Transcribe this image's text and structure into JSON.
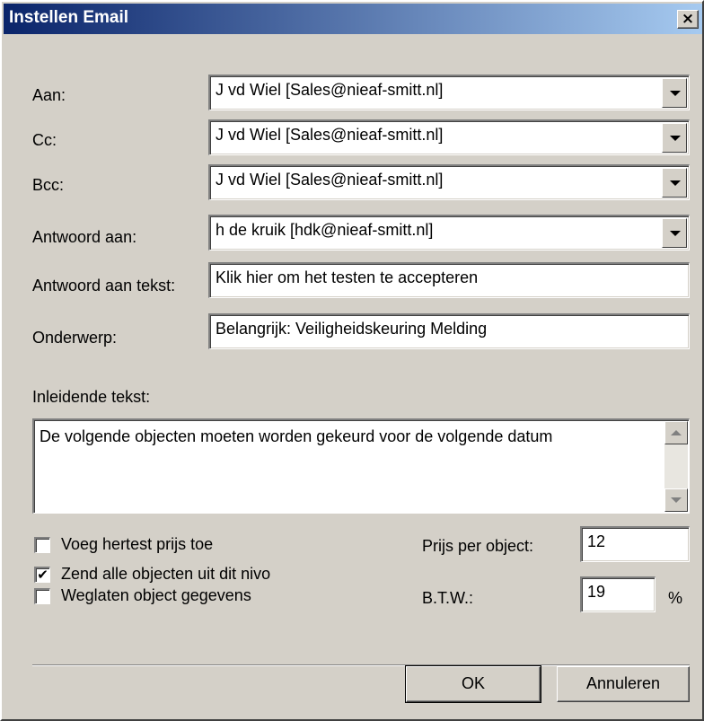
{
  "window": {
    "title": "Instellen Email",
    "close_glyph": "×"
  },
  "fields": {
    "aan": {
      "label": "Aan:",
      "value": "J vd Wiel [Sales@nieaf-smitt.nl]"
    },
    "cc": {
      "label": "Cc:",
      "value": "J vd Wiel [Sales@nieaf-smitt.nl]"
    },
    "bcc": {
      "label": "Bcc:",
      "value": "J vd Wiel [Sales@nieaf-smitt.nl]"
    },
    "antwoord_aan": {
      "label": "Antwoord aan:",
      "value": "h de kruik [hdk@nieaf-smitt.nl]"
    },
    "antwoord_tekst": {
      "label": "Antwoord aan tekst:",
      "value": "Klik hier om het testen te accepteren"
    },
    "onderwerp": {
      "label": "Onderwerp:",
      "value": "Belangrijk: Veiligheidskeuring Melding"
    }
  },
  "intro": {
    "label": "Inleidende tekst:",
    "value": "De volgende objecten moeten worden gekeurd voor de volgende datum"
  },
  "options": {
    "voeg_hertest": {
      "label": "Voeg hertest prijs toe",
      "checked": false,
      "mark": ""
    },
    "zend_alle": {
      "label": "Zend alle objecten uit dit nivo",
      "checked": true,
      "mark": "✔"
    },
    "weglaten": {
      "label": "Weglaten object gegevens",
      "checked": false,
      "mark": ""
    }
  },
  "pricing": {
    "prijs_label": "Prijs per object:",
    "prijs_value": "12",
    "btw_label": "B.T.W.:",
    "btw_value": "19",
    "btw_unit": "%"
  },
  "buttons": {
    "ok": "OK",
    "cancel": "Annuleren"
  },
  "colors": {
    "titlebar_start": "#0a246a",
    "titlebar_end": "#a6caf0",
    "face": "#d4d0c8"
  }
}
